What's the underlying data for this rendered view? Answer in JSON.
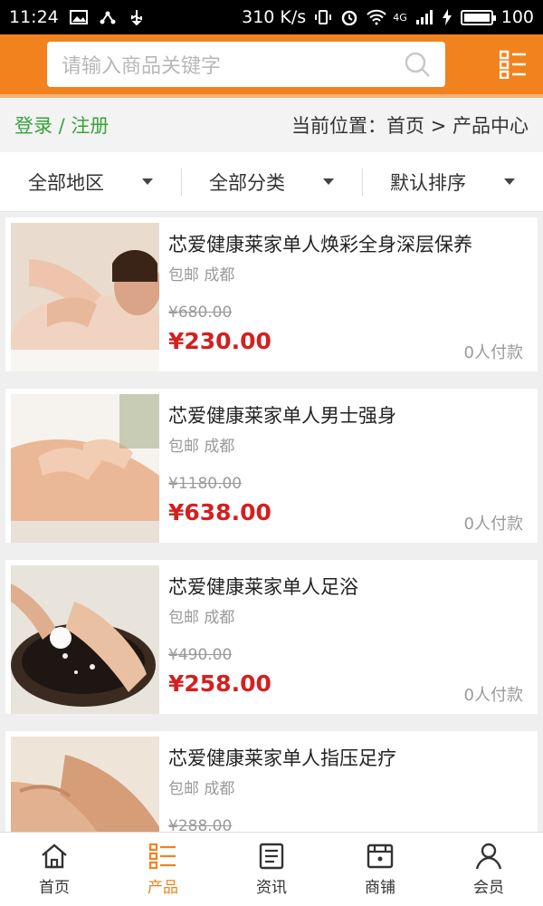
{
  "status_bar": {
    "time": "11:24",
    "net_speed": "310 K/s",
    "network": "4G",
    "battery": "100"
  },
  "search": {
    "placeholder": "请输入商品关键字"
  },
  "crumb": {
    "login_register": "登录 / 注册",
    "location": "当前位置：首页 > 产品中心"
  },
  "filters": [
    {
      "label": "全部地区"
    },
    {
      "label": "全部分类"
    },
    {
      "label": "默认排序"
    }
  ],
  "products": [
    {
      "title": "芯爱健康莱家单人焕彩全身深层保养",
      "shipping": "包邮 成都",
      "old_price": "¥680.00",
      "price": "¥230.00",
      "paid": "0人付款"
    },
    {
      "title": "芯爱健康莱家单人男士强身",
      "shipping": "包邮 成都",
      "old_price": "¥1180.00",
      "price": "¥638.00",
      "paid": "0人付款"
    },
    {
      "title": "芯爱健康莱家单人足浴",
      "shipping": "包邮 成都",
      "old_price": "¥490.00",
      "price": "¥258.00",
      "paid": "0人付款"
    },
    {
      "title": "芯爱健康莱家单人指压足疗",
      "shipping": "包邮 成都",
      "old_price": "¥288.00",
      "price": "",
      "paid": ""
    }
  ],
  "tabbar": [
    {
      "label": "首页",
      "icon": "home-icon"
    },
    {
      "label": "产品",
      "icon": "list-icon",
      "active": true
    },
    {
      "label": "资讯",
      "icon": "news-icon"
    },
    {
      "label": "商铺",
      "icon": "shop-icon"
    },
    {
      "label": "会员",
      "icon": "user-icon"
    }
  ],
  "colors": {
    "accent": "#f2821e",
    "price": "#d42020",
    "login": "#3aa23a"
  }
}
